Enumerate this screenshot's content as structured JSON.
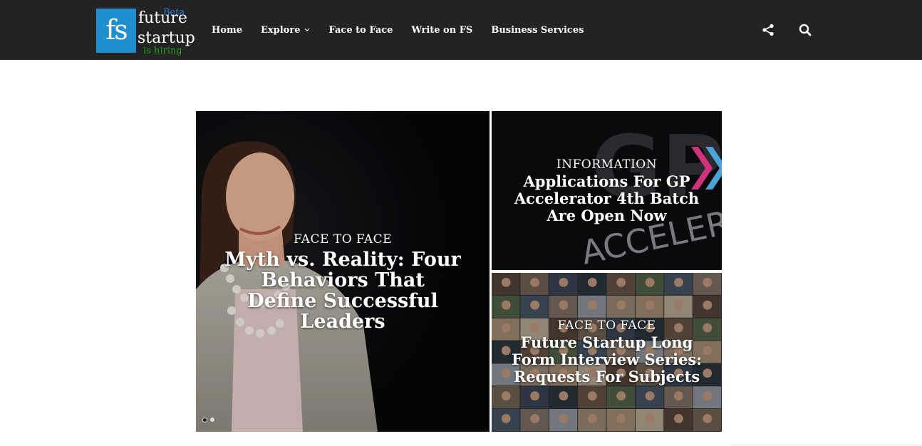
{
  "logo": {
    "initials": "fs",
    "word1": "future",
    "word2": "startup",
    "beta": "Beta",
    "hiring": "is hiring",
    "colors": {
      "box": "#1f8fd2",
      "beta": "#2a7bd6",
      "hiring": "#1aa01a"
    }
  },
  "nav": {
    "items": [
      {
        "label": "Home"
      },
      {
        "label": "Explore",
        "has_dropdown": true
      },
      {
        "label": "Face to Face"
      },
      {
        "label": "Write on FS"
      },
      {
        "label": "Business Services"
      }
    ]
  },
  "header_icons": [
    "share-icon",
    "search-icon"
  ],
  "featured": {
    "main": {
      "category": "FACE TO FACE",
      "title": "Myth vs. Reality: Four Behaviors That Define Successful Leaders"
    },
    "side_top": {
      "category": "INFORMATION",
      "title": "Applications For GP Accelerator 4th Batch Are Open Now",
      "image_text": [
        "GP",
        "ACCELERATOR"
      ]
    },
    "side_bottom": {
      "category": "FACE TO FACE",
      "title": "Future Startup Long Form Interview Series: Requests For Subjects"
    }
  },
  "slider": {
    "slide_count": 2,
    "active_index": 0
  },
  "colors": {
    "header_bg": "#232323",
    "page_bg": "#ffffff"
  }
}
